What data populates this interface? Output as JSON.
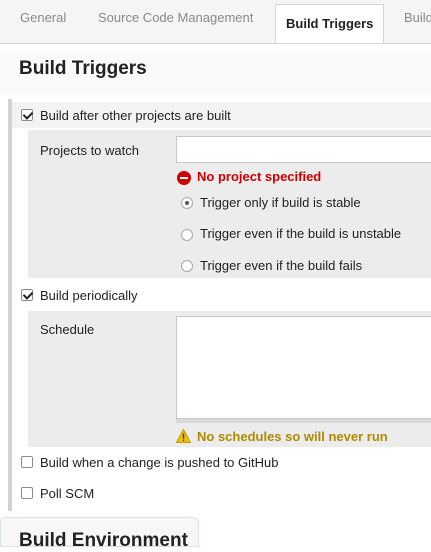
{
  "tabs": [
    {
      "label": "General"
    },
    {
      "label": "Source Code Management"
    },
    {
      "label": "Build Triggers",
      "active": true
    },
    {
      "label": "Build"
    }
  ],
  "section": {
    "title": "Build Triggers"
  },
  "triggers": {
    "after_other": {
      "label": "Build after other projects are built",
      "checked": true
    },
    "projects_to_watch": {
      "label": "Projects to watch",
      "value": ""
    },
    "error": "No project specified",
    "radio_options": [
      {
        "label": "Trigger only if build is stable",
        "selected": true
      },
      {
        "label": "Trigger even if the build is unstable",
        "selected": false
      },
      {
        "label": "Trigger even if the build fails",
        "selected": false
      }
    ],
    "periodically": {
      "label": "Build periodically",
      "checked": true
    },
    "schedule": {
      "label": "Schedule",
      "value": ""
    },
    "warning": "No schedules so will never run",
    "github": {
      "label": "Build when a change is pushed to GitHub",
      "checked": false
    },
    "poll_scm": {
      "label": "Poll SCM",
      "checked": false
    }
  },
  "next_section": {
    "title": "Build Environment"
  },
  "colors": {
    "error": "#cc0000",
    "warning": "#b08a00",
    "warning_icon": "#f0c000"
  }
}
